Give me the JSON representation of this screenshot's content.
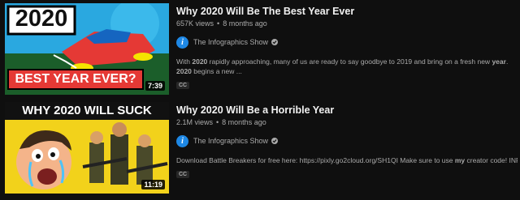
{
  "results": [
    {
      "thumbnail": {
        "headline_top": "2020",
        "headline_bottom": "BEST YEAR EVER?",
        "duration": "7:39"
      },
      "title": "Why 2020 Will Be The Best Year Ever",
      "views": "657K views",
      "age": "8 months ago",
      "channel": "The Infographics Show",
      "avatar_letter": "i",
      "description": {
        "p1": "With ",
        "b1": "2020",
        "p2": " rapidly approaching, many of us are ready to say goodbye to 2019 and bring on a fresh new ",
        "b2": "year",
        "p3": ". ",
        "b3": "2020",
        "p4": " begins a new ..."
      },
      "badge": "CC"
    },
    {
      "thumbnail": {
        "headline_top": "WHY 2020 WILL SUCK",
        "duration": "11:19"
      },
      "title": "Why 2020 Will Be a Horrible Year",
      "views": "2.1M views",
      "age": "8 months ago",
      "channel": "The Infographics Show",
      "avatar_letter": "i",
      "description": {
        "p1": "Download Battle Breakers for free here: https://pixly.go2cloud.org/SH1QI Make sure to use ",
        "b1": "my",
        "p2": " creator code! INFOGRAPHICS"
      },
      "badge": "CC"
    }
  ],
  "colors": {
    "background": "#0f0f0f",
    "title": "#f1f1f1",
    "meta": "#aaaaaa",
    "avatar": "#1e88e5",
    "thumb1_top": "#2aa8e0",
    "thumb1_bottom": "#1b5e2a",
    "thumb2_bg": "#f2d21b"
  }
}
